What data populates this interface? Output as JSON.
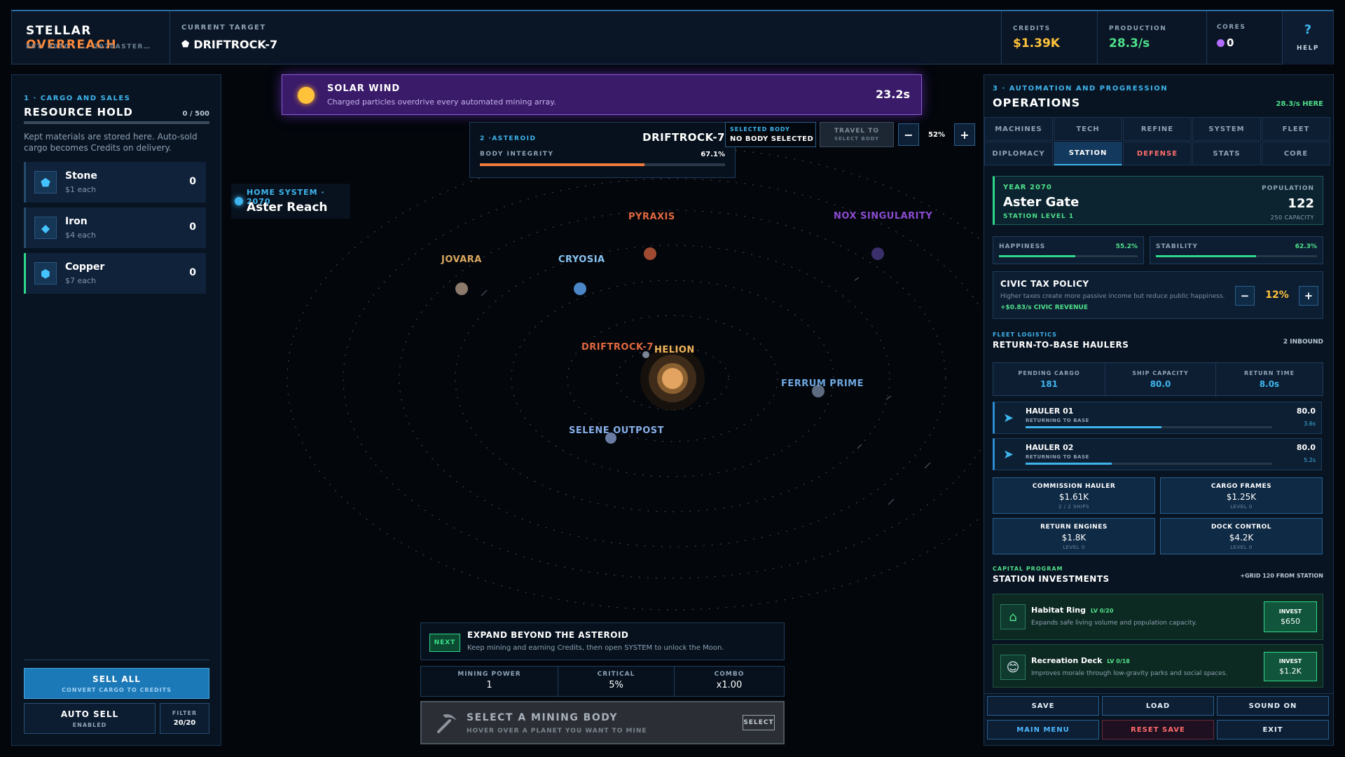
{
  "header": {
    "title_a": "STELLAR",
    "title_b": "OVERREACH",
    "subtitle": "EST. 2070 · … ·2070ASTER…",
    "target_label": "CURRENT TARGET",
    "target_value": "DRIFTROCK-7",
    "credits_label": "CREDITS",
    "credits_value": "$1.39K",
    "production_label": "PRODUCTION",
    "production_value": "28.3/s",
    "cores_label": "CORES",
    "cores_value": "0",
    "help_icon": "?",
    "help_label": "HELP"
  },
  "left": {
    "section": "1 · CARGO AND SALES",
    "title": "RESOURCE HOLD",
    "capacity": "0 / 500",
    "capacity_fraction": 0,
    "desc": "Kept materials are stored here. Auto-sold cargo becomes Credits on delivery.",
    "resources": [
      {
        "name": "Stone",
        "price": "$1 each",
        "count": "0",
        "icon": "pentagon-icon"
      },
      {
        "name": "Iron",
        "price": "$4 each",
        "count": "0",
        "icon": "diamond-icon"
      },
      {
        "name": "Copper",
        "price": "$7 each",
        "count": "0",
        "icon": "hexagon-icon"
      }
    ],
    "sell_all": "SELL ALL",
    "sell_all_sub": "CONVERT CARGO TO CREDITS",
    "auto_sell": "AUTO SELL",
    "auto_sell_sub": "ENABLED",
    "filter": "FILTER",
    "filter_value": "20/20"
  },
  "event": {
    "title": "SOLAR WIND",
    "desc": "Charged particles overdrive every automated mining array.",
    "timer": "23.2s"
  },
  "asteroid": {
    "section": "2 ·ASTEROID",
    "name": "DRIFTROCK-7",
    "integrity_label": "BODY INTEGRITY",
    "integrity_value": "67.1%",
    "integrity_fraction": 0.671
  },
  "selection": {
    "label": "SELECTED BODY",
    "value": "NO BODY SELECTED",
    "travel": "TRAVEL TO",
    "travel_sub": "SELECT BODY",
    "zoom_minus": "−",
    "zoom_value": "52%",
    "zoom_plus": "+"
  },
  "home": {
    "label": "HOME SYSTEM · 2070",
    "name": "Aster Reach"
  },
  "planets": {
    "pyraxis": "PYRAXIS",
    "nox": "NOX SINGULARITY",
    "jovara": "JOVARA",
    "cryosia": "CRYOSIA",
    "driftrock": "DRIFTROCK-7",
    "helion": "HELION",
    "ferrum": "FERRUM PRIME",
    "selene": "SELENE OUTPOST"
  },
  "objective": {
    "badge": "NEXT",
    "title": "EXPAND BEYOND THE ASTEROID",
    "desc": "Keep mining and earning Credits, then open SYSTEM to unlock the Moon."
  },
  "mining_stats": [
    {
      "label": "MINING POWER",
      "value": "1"
    },
    {
      "label": "CRITICAL",
      "value": "5%"
    },
    {
      "label": "COMBO",
      "value": "x1.00"
    }
  ],
  "mining_select": {
    "title": "SELECT A MINING BODY",
    "sub": "HOVER OVER A PLANET YOU WANT TO MINE",
    "button": "SELECT"
  },
  "right": {
    "section": "3 · AUTOMATION AND PROGRESSION",
    "title": "OPERATIONS",
    "rate": "28.3/s HERE",
    "tabs_row1": [
      "MACHINES",
      "TECH",
      "REFINE",
      "SYSTEM",
      "FLEET"
    ],
    "tabs_row2": [
      "DIPLOMACY",
      "STATION",
      "DEFENSE",
      "STATS",
      "CORE"
    ],
    "station": {
      "year": "YEAR 2070",
      "name": "Aster Gate",
      "level": "STATION LEVEL 1",
      "pop_label": "POPULATION",
      "pop_value": "122",
      "capacity": "250 CAPACITY"
    },
    "happiness_label": "HAPPINESS",
    "happiness_value": "55.2%",
    "happiness_fraction": 0.552,
    "stability_label": "STABILITY",
    "stability_value": "62.3%",
    "stability_fraction": 0.623,
    "tax": {
      "title": "CIVIC TAX POLICY",
      "desc": "Higher taxes create more passive income but reduce public happiness.",
      "revenue": "+$0.83/s CIVIC REVENUE",
      "minus": "−",
      "value": "12%",
      "plus": "+"
    },
    "fleet": {
      "section": "FLEET LOGISTICS",
      "title": "RETURN-TO-BASE HAULERS",
      "inbound": "2 INBOUND",
      "stats": [
        {
          "label": "PENDING CARGO",
          "value": "181"
        },
        {
          "label": "SHIP CAPACITY",
          "value": "80.0"
        },
        {
          "label": "RETURN TIME",
          "value": "8.0s"
        }
      ],
      "haulers": [
        {
          "name": "HAULER 01",
          "status": "RETURNING TO BASE",
          "cargo": "80.0",
          "time": "3.6s",
          "progress": 0.55
        },
        {
          "name": "HAULER 02",
          "status": "RETURNING TO BASE",
          "cargo": "80.0",
          "time": "5.2s",
          "progress": 0.35
        }
      ],
      "upgrades": [
        {
          "title": "COMMISSION HAULER",
          "cost": "$1.61K",
          "sub": "2 / 2 SHIPS"
        },
        {
          "title": "CARGO FRAMES",
          "cost": "$1.25K",
          "sub": "LEVEL 0"
        },
        {
          "title": "RETURN ENGINES",
          "cost": "$1.8K",
          "sub": "LEVEL 0"
        },
        {
          "title": "DOCK CONTROL",
          "cost": "$4.2K",
          "sub": "LEVEL 0"
        }
      ]
    },
    "capital": {
      "section": "CAPITAL PROGRAM",
      "title": "STATION INVESTMENTS",
      "grid": "+GRID 120 FROM STATION",
      "items": [
        {
          "name": "Habitat Ring",
          "level": "LV 0/20",
          "desc": "Expands safe living volume and population capacity.",
          "invest": "INVEST",
          "cost": "$650",
          "icon": "home-icon"
        },
        {
          "name": "Recreation Deck",
          "level": "LV 0/18",
          "desc": "Improves morale through low-gravity parks and social spaces.",
          "invest": "INVEST",
          "cost": "$1.2K",
          "icon": "smile-icon"
        }
      ]
    },
    "buttons": {
      "save": "SAVE",
      "load": "LOAD",
      "sound": "SOUND ON",
      "menu": "MAIN MENU",
      "reset": "RESET SAVE",
      "exit": "EXIT"
    }
  }
}
